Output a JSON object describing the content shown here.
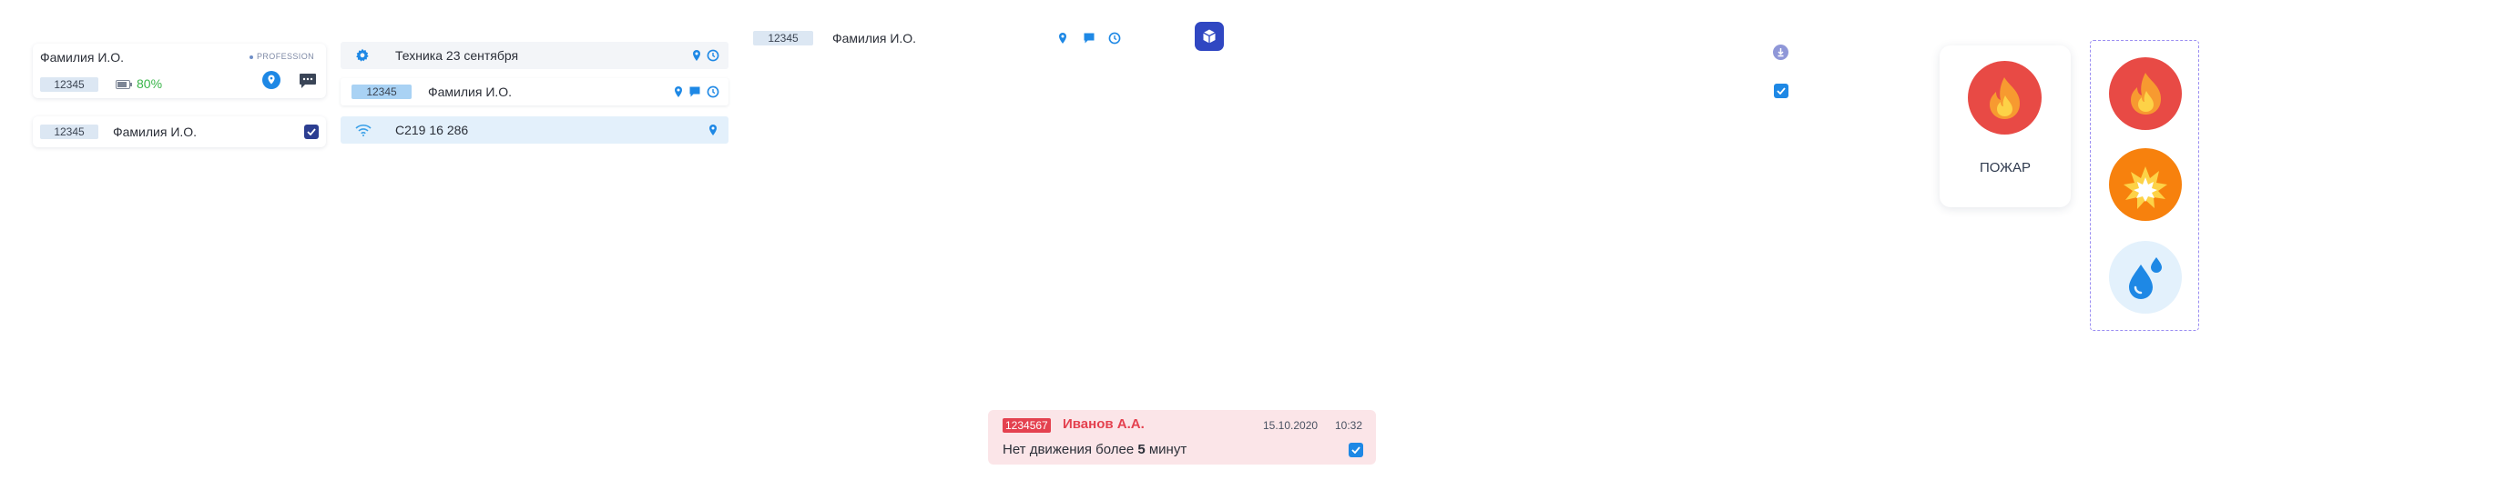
{
  "colors": {
    "accent": "#1e88e5",
    "indigo": "#3047c2",
    "fire_red": "#e84a45",
    "explosion_orange": "#f7810d",
    "water_bg": "#e3f1fc",
    "alert_bg": "#fbe5e8",
    "alert_red": "#e4414f",
    "battery_green": "#3ab54a",
    "selected_row": "#e3f0fb"
  },
  "card1": {
    "name": "Фамилия И.О.",
    "profession": "PROFESSION",
    "tag": "12345",
    "battery": "80%",
    "icons": [
      "map-pin-icon",
      "chat-icon"
    ]
  },
  "card2": {
    "tag": "12345",
    "name": "Фамилия И.О.",
    "checked": true
  },
  "equipment_row": {
    "icon": "gear-icon",
    "label": "Техника 23 сентября",
    "icons": [
      "map-pin-icon",
      "clock-icon"
    ]
  },
  "person_row": {
    "tag": "12345",
    "name": "Фамилия И.О.",
    "icons": [
      "map-pin-icon",
      "chat-icon",
      "clock-icon"
    ]
  },
  "wifi_row": {
    "icon": "wifi-icon",
    "label": "С219 16 286",
    "icons": [
      "map-pin-icon"
    ]
  },
  "top_row": {
    "tag": "12345",
    "name": "Фамилия И.О.",
    "icons": [
      "map-pin-icon",
      "chat-icon",
      "clock-icon"
    ],
    "app_button_icon": "cube-icon"
  },
  "right_controls": {
    "download_icon": "download-icon",
    "checked": true
  },
  "fire_card": {
    "label": "ПОЖАР",
    "icon": "fire-icon"
  },
  "incident_picker": {
    "options": [
      "fire-icon",
      "explosion-icon",
      "water-drop-icon"
    ]
  },
  "alert": {
    "badge": "1234567",
    "name": "Иванов А.А.",
    "date": "15.10.2020",
    "time": "10:32",
    "message_prefix": "Нет движения более ",
    "message_value": "5",
    "message_suffix": " минут",
    "checked": true
  }
}
